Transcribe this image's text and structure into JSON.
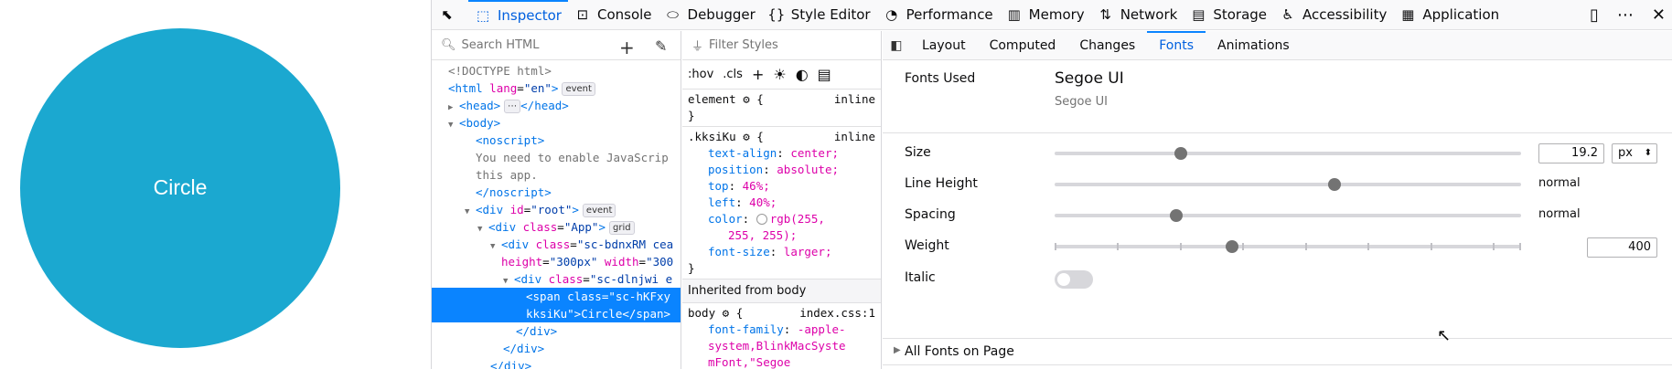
{
  "page": {
    "circle_label": "Circle"
  },
  "toolbar": {
    "tools": [
      {
        "label": "Inspector",
        "icon": "inspector-icon",
        "glyph": "⬚"
      },
      {
        "label": "Console",
        "icon": "console-icon",
        "glyph": "⊡"
      },
      {
        "label": "Debugger",
        "icon": "debugger-icon",
        "glyph": "⬭"
      },
      {
        "label": "Style Editor",
        "icon": "style-editor-icon",
        "glyph": "{}"
      },
      {
        "label": "Performance",
        "icon": "performance-icon",
        "glyph": "◔"
      },
      {
        "label": "Memory",
        "icon": "memory-icon",
        "glyph": "▥"
      },
      {
        "label": "Network",
        "icon": "network-icon",
        "glyph": "⇅"
      },
      {
        "label": "Storage",
        "icon": "storage-icon",
        "glyph": "▤"
      },
      {
        "label": "Accessibility",
        "icon": "accessibility-icon",
        "glyph": "♿"
      },
      {
        "label": "Application",
        "icon": "application-icon",
        "glyph": "▦"
      }
    ],
    "active": "Inspector"
  },
  "markup": {
    "search_placeholder": "Search HTML",
    "lines": {
      "doctype": "<!DOCTYPE html>",
      "html_open": "<html",
      "html_attr": "lang",
      "html_val": "\"en\"",
      "event_badge": "event",
      "head": "<head>",
      "head_ellipsis": "⋯",
      "head_close": "</head>",
      "body_open": "<body>",
      "noscript_open": "<noscript>",
      "noscript_text1": "You need to enable JavaScrip",
      "noscript_text2": "this app.",
      "noscript_close": "</noscript>",
      "root_div": "<div",
      "root_attr": "id",
      "root_val": "\"root\"",
      "app_attr": "class",
      "app_val": "\"App\"",
      "grid_badge": "grid",
      "sc1_val": "\"sc-bdnxRM cea",
      "sc1_cont_attr": "height",
      "sc1_cont_val": "\"300px\"",
      "sc1_cont_attr2": "width",
      "sc1_cont_val2": "\"300",
      "sc2_val": "\"sc-dlnjwi e",
      "span_open": "<span",
      "span_val": "\"sc-hKFxy",
      "span_cont": "kksiKu\">Circle</span>",
      "div_close": "</div>",
      "div_close2": "</div>",
      "div_close3": "</div>"
    }
  },
  "rules": {
    "filter_placeholder": "Filter Styles",
    "hov": ":hov",
    "cls": ".cls",
    "element_selector": "element",
    "inline": "inline",
    "kk_selector": ".kksiKu",
    "decls": [
      {
        "p": "text-align",
        "v": "center;"
      },
      {
        "p": "position",
        "v": "absolute;"
      },
      {
        "p": "top",
        "v": "46%;"
      },
      {
        "p": "left",
        "v": "40%;"
      },
      {
        "p": "color",
        "v": "rgb(255,",
        "v2": "255, 255);"
      },
      {
        "p": "font-size",
        "v": "larger;"
      }
    ],
    "inherited_label": "Inherited from body",
    "body_selector": "body",
    "body_src": "index.css:1",
    "body_decl_p": "font-family",
    "body_decl_v1": "-apple-",
    "body_decl_v2": "system,BlinkMacSyste",
    "body_decl_v3": "mFont,\"Segoe"
  },
  "side": {
    "tabs": [
      "Layout",
      "Computed",
      "Changes",
      "Fonts",
      "Animations"
    ],
    "active": "Fonts",
    "fonts_used_label": "Fonts Used",
    "font_name": "Segoe UI",
    "font_sub": "Segoe UI",
    "size_label": "Size",
    "size_value": "19.2",
    "size_unit": "px",
    "line_height_label": "Line Height",
    "line_height_value": "normal",
    "spacing_label": "Spacing",
    "spacing_value": "normal",
    "weight_label": "Weight",
    "weight_value": "400",
    "italic_label": "Italic",
    "all_fonts_label": "All Fonts on Page",
    "slider_levels": {
      "size": 0.27,
      "line_height": 0.6,
      "spacing": 0.26,
      "weight": 0.38
    }
  }
}
